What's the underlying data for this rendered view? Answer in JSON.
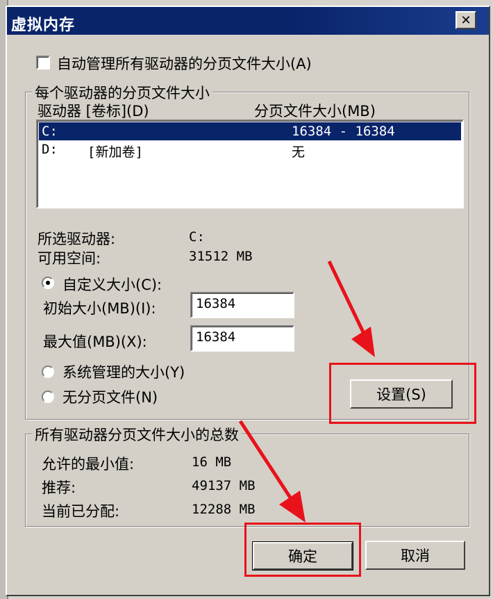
{
  "window": {
    "title": "虚拟内存",
    "close_glyph": "✕"
  },
  "auto_manage": {
    "label": "自动管理所有驱动器的分页文件大小(A)",
    "checked": false
  },
  "per_drive": {
    "legend": "每个驱动器的分页文件大小",
    "col_drive": "驱动器 [卷标](D)",
    "col_size": "分页文件大小(MB)",
    "rows": [
      {
        "drive": "C:",
        "label": "",
        "size": "16384 - 16384",
        "selected": true
      },
      {
        "drive": "D:",
        "label": "[新加卷]",
        "size": "无",
        "selected": false
      }
    ],
    "selected_drive_label": "所选驱动器:",
    "selected_drive_value": "C:",
    "free_space_label": "可用空间:",
    "free_space_value": "31512 MB",
    "custom_size_label": "自定义大小(C):",
    "initial_label": "初始大小(MB)(I):",
    "initial_value": "16384",
    "max_label": "最大值(MB)(X):",
    "max_value": "16384",
    "system_managed_label": "系统管理的大小(Y)",
    "no_paging_label": "无分页文件(N)",
    "set_button": "设置(S)"
  },
  "totals": {
    "legend": "所有驱动器分页文件大小的总数",
    "min_label": "允许的最小值:",
    "min_value": "16 MB",
    "recommended_label": "推荐:",
    "recommended_value": "49137 MB",
    "allocated_label": "当前已分配:",
    "allocated_value": "12288 MB"
  },
  "buttons": {
    "ok": "确定",
    "cancel": "取消"
  },
  "colors": {
    "titlebar": "#0a246a",
    "selection": "#0a246a",
    "highlight": "#e8121b",
    "face": "#d4d0c8"
  }
}
